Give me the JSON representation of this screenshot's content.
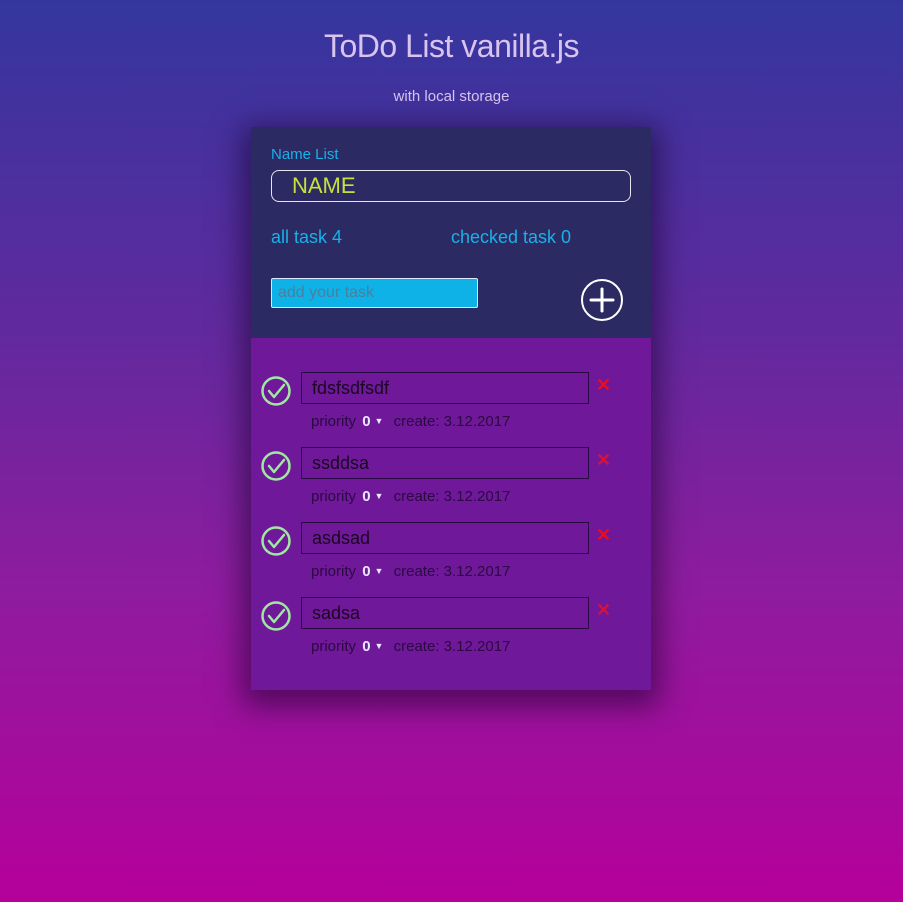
{
  "header": {
    "title": "ToDo List vanilla.js",
    "subtitle": "with local storage"
  },
  "list": {
    "name_label": "Name List",
    "name_value": "NAME",
    "all_task_label": "all task 4",
    "checked_task_label": "checked task 0",
    "add_placeholder": "add your task",
    "add_button_icon": "plus-circle-icon"
  },
  "tasks": [
    {
      "text": "fdsfsdfsdf",
      "priority_label": "priority",
      "priority": "0",
      "created": "create: 3.12.2017",
      "delete": "✕"
    },
    {
      "text": "ssddsa",
      "priority_label": "priority",
      "priority": "0",
      "created": "create: 3.12.2017",
      "delete": "✕"
    },
    {
      "text": "asdsad",
      "priority_label": "priority",
      "priority": "0",
      "created": "create: 3.12.2017",
      "delete": "✕"
    },
    {
      "text": "sadsa",
      "priority_label": "priority",
      "priority": "0",
      "created": "create: 3.12.2017",
      "delete": "✕"
    }
  ],
  "colors": {
    "accent": "#1ab0e8",
    "name_text": "#c8e03a",
    "check": "#9fe8a0",
    "delete": "#e0102a"
  }
}
